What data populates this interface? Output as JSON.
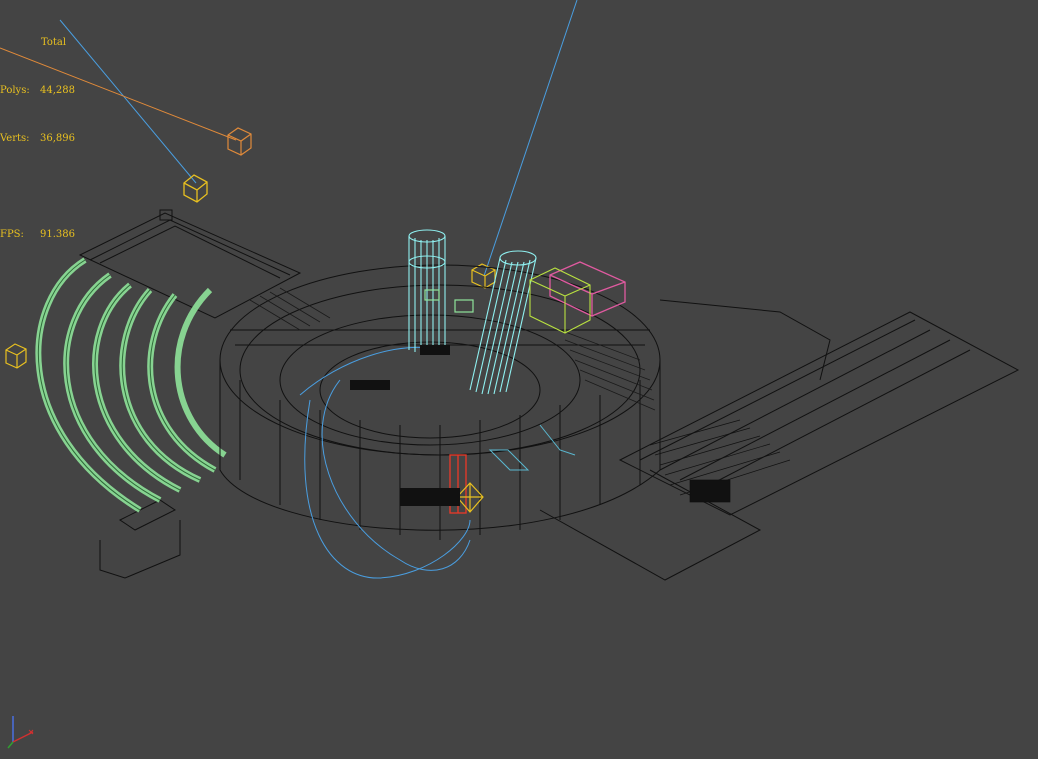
{
  "viewport": {
    "background": "#444444",
    "mode": "wireframe"
  },
  "stats": {
    "header": "Total",
    "polys_label": "Polys:",
    "polys_value": "44,288",
    "verts_label": "Verts:",
    "verts_value": "36,896",
    "fps_label": "FPS:",
    "fps_value": "91.386"
  },
  "colors": {
    "stats_text": "#e8c020",
    "geometry_wire": "#111111",
    "pipes": "#8fe39a",
    "columns": "#8ff0f0",
    "light_target": "#e8c020",
    "light_orange": "#e08a3a",
    "camera_line_blue": "#4a9ee0",
    "selection_red": "#e03a2a",
    "box_pink": "#e05aa0",
    "box_lime": "#b8e040"
  },
  "axis_gizmo": {
    "icon": "xyz-axis-icon"
  }
}
